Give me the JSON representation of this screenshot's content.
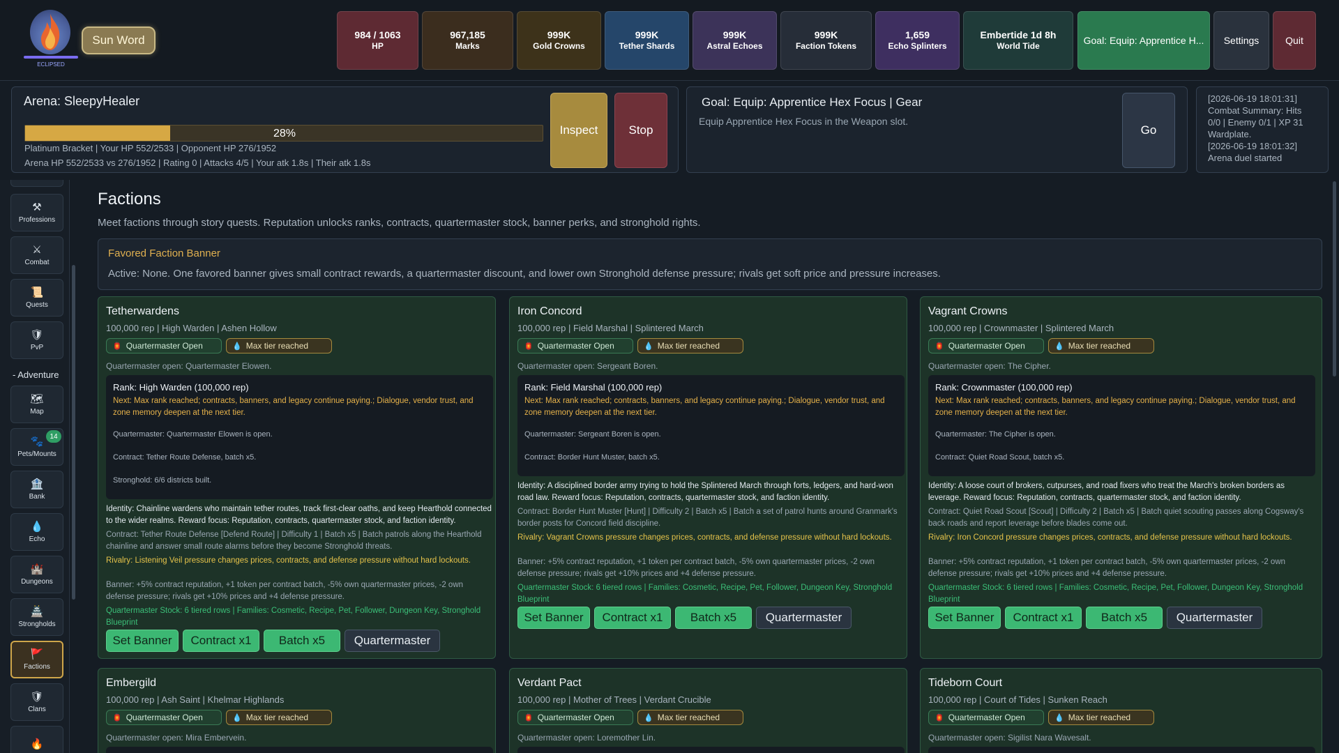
{
  "logo": {
    "label": "ECLIPSED"
  },
  "sunword": "Sun Word",
  "stats": [
    {
      "value": "984 / 1063",
      "key": "HP",
      "color": "#5e2a33"
    },
    {
      "value": "967,185",
      "key": "Marks",
      "color": "#3b2d1e"
    },
    {
      "value": "999K",
      "key": "Gold Crowns",
      "color": "#3d321a"
    },
    {
      "value": "999K",
      "key": "Tether Shards",
      "color": "#25466a"
    },
    {
      "value": "999K",
      "key": "Astral Echoes",
      "color": "#3c3359"
    },
    {
      "value": "999K",
      "key": "Faction Tokens",
      "color": "#262d38"
    },
    {
      "value": "1,659",
      "key": "Echo Splinters",
      "color": "#3e2f60"
    },
    {
      "value": "Embertide 1d 8h",
      "key": "World Tide",
      "color": "#1f3b39"
    }
  ],
  "top_buttons": {
    "goal": "Goal: Equip: Apprentice H...",
    "settings": "Settings",
    "quit": "Quit"
  },
  "arena": {
    "title": "Arena: SleepyHealer",
    "progress": 28,
    "progress_label": "28%",
    "line1": "Platinum Bracket | Your HP 552/2533 | Opponent HP 276/1952",
    "line2": "Arena HP 552/2533 vs 276/1952 | Rating 0 | Attacks 4/5 | Your atk 1.8s | Their atk 1.8s",
    "inspect": "Inspect",
    "stop": "Stop"
  },
  "goal": {
    "title": "Goal: Equip: Apprentice Hex Focus | Gear",
    "desc": "Equip Apprentice Hex Focus in the Weapon slot.",
    "go": "Go"
  },
  "log": [
    "[2026-06-19 18:01:31] Combat Summary: Hits 0/0 | Enemy 0/1 | XP 31 Wardplate.",
    "[2026-06-19 18:01:32] Arena duel started"
  ],
  "sidebar": {
    "items": [
      {
        "label": "Professions",
        "icon": "professions-icon",
        "glyph": "⚒"
      },
      {
        "label": "Combat",
        "icon": "combat-icon",
        "glyph": "⚔"
      },
      {
        "label": "Quests",
        "icon": "quests-icon",
        "glyph": "📜"
      },
      {
        "label": "PvP",
        "icon": "pvp-icon",
        "glyph": "🛡"
      },
      {
        "label": "Map",
        "icon": "map-icon",
        "glyph": "🗺"
      },
      {
        "label": "Pets/Mounts",
        "icon": "pets-icon",
        "glyph": "🐾",
        "badge": "14"
      },
      {
        "label": "Bank",
        "icon": "bank-icon",
        "glyph": "🏦"
      },
      {
        "label": "Echo",
        "icon": "echo-icon",
        "glyph": "💧"
      },
      {
        "label": "Dungeons",
        "icon": "dungeons-icon",
        "glyph": "🏰"
      },
      {
        "label": "Strongholds",
        "icon": "strongholds-icon",
        "glyph": "🏯"
      },
      {
        "label": "Factions",
        "icon": "factions-icon",
        "glyph": "🚩"
      },
      {
        "label": "Clans",
        "icon": "clans-icon",
        "glyph": "🛡"
      }
    ],
    "adventure_header": "- Adventure"
  },
  "main": {
    "title": "Factions",
    "subtitle": "Meet factions through story quests. Reputation unlocks ranks, contracts, quartermaster stock, banner perks, and stronghold rights.",
    "favored": {
      "title": "Favored Faction Banner",
      "text": "Active: None. One favored banner gives small contract rewards, a quartermaster discount, and lower own Stronghold defense pressure; rivals get soft price and pressure increases."
    }
  },
  "common": {
    "qm_open": "Quartermaster Open",
    "max_tier": "Max tier reached",
    "next_text": "Next: Max rank reached; contracts, banners, and legacy continue paying.; Dialogue, vendor trust, and zone memory deepen at the next tier.",
    "banner_text": "Banner: +5% contract reputation, +1 token per contract batch, -5% own quartermaster prices, -2 own defense pressure; rivals get +10% prices and +4 defense pressure.",
    "stock_text": "Quartermaster Stock: 6 tiered rows | Families: Cosmetic, Recipe, Pet, Follower, Dungeon Key, Stronghold Blueprint",
    "btn_banner": "Set Banner",
    "btn_contract": "Contract x1",
    "btn_batch": "Batch x5",
    "btn_qm": "Quartermaster"
  },
  "factions": [
    {
      "name": "Tetherwardens",
      "meta": "100,000 rep | High Warden | Ashen Hollow",
      "qm_open_line": "Quartermaster open: Quartermaster Elowen.",
      "rank": "Rank: High Warden (100,000 rep)",
      "qm_line": "Quartermaster: Quartermaster Elowen is open.",
      "contract_line": "Contract: Tether Route Defense, batch x5.",
      "stronghold_line": "Stronghold: 6/6 districts built.",
      "identity": "Identity: Chainline wardens who maintain tether routes, track first-clear oaths, and keep Hearthold connected to the wider realms. Reward focus: Reputation, contracts, quartermaster stock, and faction identity.",
      "contract_detail": "Contract: Tether Route Defense [Defend Route] | Difficulty 1 | Batch x5 | Batch patrols along the Hearthold chainline and answer small route alarms before they become Stronghold threats.",
      "rivalry": "Rivalry: Listening Veil pressure changes prices, contracts, and defense pressure without hard lockouts."
    },
    {
      "name": "Iron Concord",
      "meta": "100,000 rep | Field Marshal | Splintered March",
      "qm_open_line": "Quartermaster open: Sergeant Boren.",
      "rank": "Rank: Field Marshal (100,000 rep)",
      "qm_line": "Quartermaster: Sergeant Boren is open.",
      "contract_line": "Contract: Border Hunt Muster, batch x5.",
      "identity": "Identity: A disciplined border army trying to hold the Splintered March through forts, ledgers, and hard-won road law. Reward focus: Reputation, contracts, quartermaster stock, and faction identity.",
      "contract_detail": "Contract: Border Hunt Muster [Hunt] | Difficulty 2 | Batch x5 | Batch a set of patrol hunts around Granmark's border posts for Concord field discipline.",
      "rivalry": "Rivalry: Vagrant Crowns pressure changes prices, contracts, and defense pressure without hard lockouts."
    },
    {
      "name": "Vagrant Crowns",
      "meta": "100,000 rep | Crownmaster | Splintered March",
      "qm_open_line": "Quartermaster open: The Cipher.",
      "rank": "Rank: Crownmaster (100,000 rep)",
      "qm_line": "Quartermaster: The Cipher is open.",
      "contract_line": "Contract: Quiet Road Scout, batch x5.",
      "identity": "Identity: A loose court of brokers, cutpurses, and road fixers who treat the March's broken borders as leverage. Reward focus: Reputation, contracts, quartermaster stock, and faction identity.",
      "contract_detail": "Contract: Quiet Road Scout [Scout] | Difficulty 2 | Batch x5 | Batch quiet scouting passes along Cogsway's back roads and report leverage before blades come out.",
      "rivalry": "Rivalry: Iron Concord pressure changes prices, contracts, and defense pressure without hard lockouts."
    },
    {
      "name": "Embergild",
      "meta": "100,000 rep | Ash Saint | Khelmar Highlands",
      "qm_open_line": "Quartermaster open: Mira Embervein."
    },
    {
      "name": "Verdant Pact",
      "meta": "100,000 rep | Mother of Trees | Verdant Crucible",
      "qm_open_line": "Quartermaster open: Loremother Lin."
    },
    {
      "name": "Tideborn Court",
      "meta": "100,000 rep | Court of Tides | Sunken Reach",
      "qm_open_line": "Quartermaster open: Sigilist Nara Wavesalt."
    }
  ]
}
